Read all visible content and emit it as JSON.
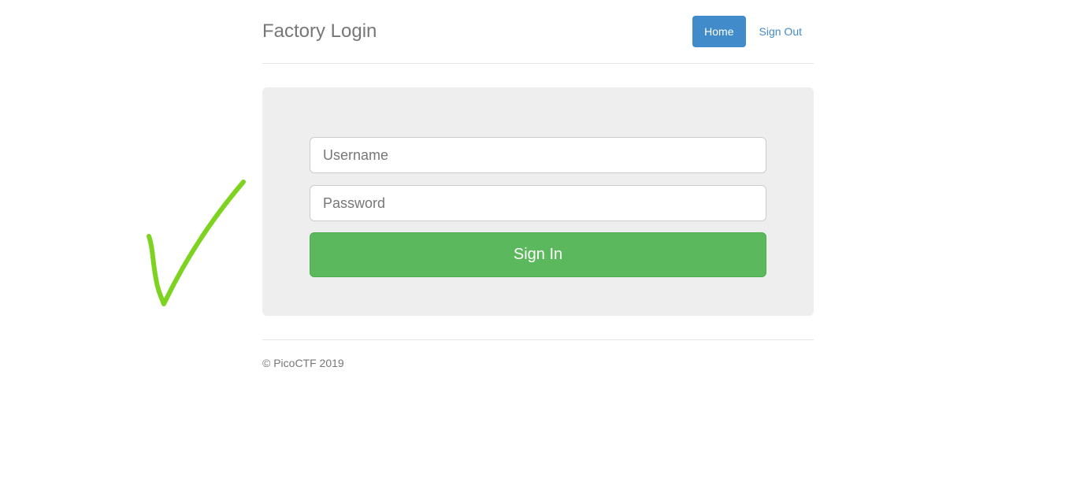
{
  "header": {
    "brand": "Factory Login",
    "nav": {
      "home_label": "Home",
      "signout_label": "Sign Out"
    }
  },
  "login_form": {
    "username": {
      "value": "",
      "placeholder": "Username"
    },
    "password": {
      "value": "",
      "placeholder": "Password"
    },
    "signin_label": "Sign In"
  },
  "footer": {
    "text": "© PicoCTF 2019"
  },
  "annotation": {
    "icon": "checkmark-icon",
    "color": "#7ed321"
  },
  "colors": {
    "primary": "#428bca",
    "success": "#5cb85c",
    "jumbotron_bg": "#eeeeee"
  }
}
